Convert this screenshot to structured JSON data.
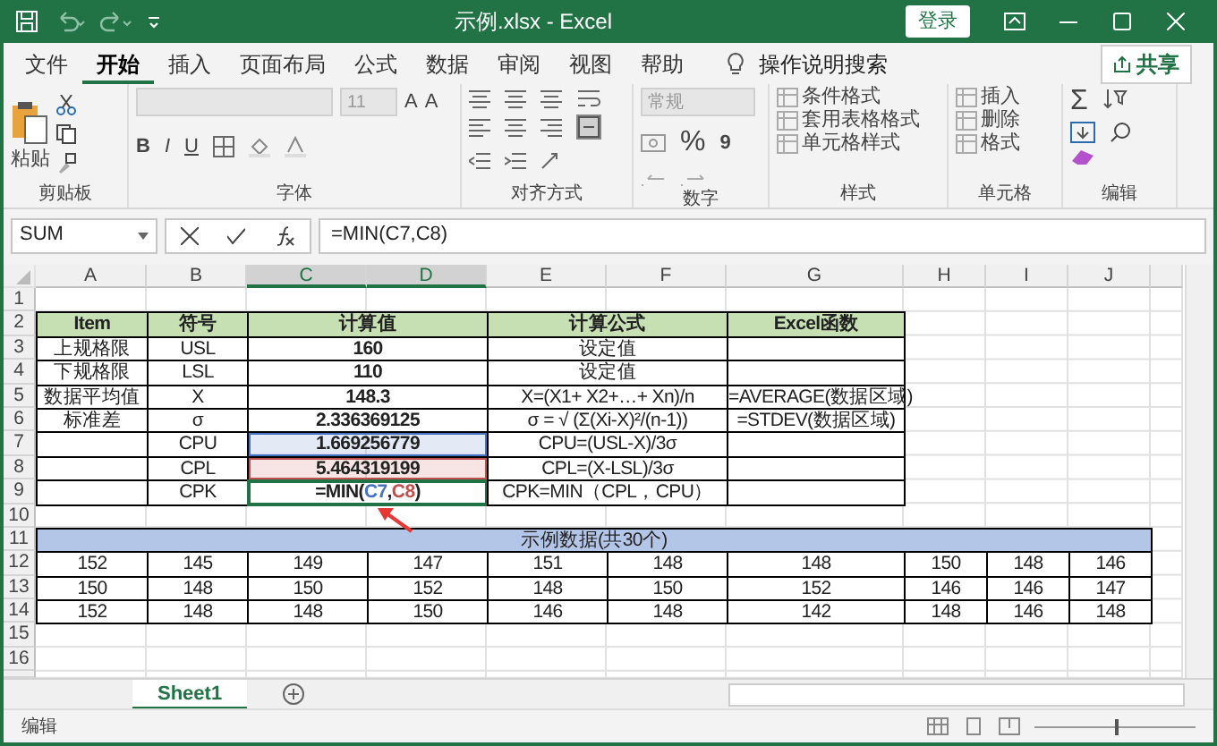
{
  "title_bar": {
    "title": "示例.xlsx  -  Excel",
    "login_button": "登录"
  },
  "tabs": [
    {
      "label": "文件",
      "selected": false
    },
    {
      "label": "开始",
      "selected": true
    },
    {
      "label": "插入",
      "selected": false
    },
    {
      "label": "页面布局",
      "selected": false
    },
    {
      "label": "公式",
      "selected": false
    },
    {
      "label": "数据",
      "selected": false
    },
    {
      "label": "审阅",
      "selected": false
    },
    {
      "label": "视图",
      "selected": false
    },
    {
      "label": "帮助",
      "selected": false
    }
  ],
  "tell_me": "操作说明搜索",
  "share_button": "共享",
  "ribbon": {
    "clipboard": {
      "label": "剪贴板",
      "paste": "粘贴"
    },
    "font": {
      "label": "字体",
      "size": "11",
      "grow": "A",
      "shrink": "A",
      "styles": [
        "B",
        "I",
        "U"
      ],
      "disabled": true
    },
    "alignment": {
      "label": "对齐方式",
      "merge_selected": true
    },
    "number": {
      "label": "数字",
      "format": "常规",
      "percent": "%",
      "comma": "9",
      "disabled": true
    },
    "styles": {
      "label": "样式",
      "items": [
        {
          "label": "条件格式",
          "disabled": true
        },
        {
          "label": "套用表格格式",
          "disabled": true
        },
        {
          "label": "单元格样式",
          "disabled": true
        }
      ]
    },
    "cells": {
      "label": "单元格",
      "items": [
        {
          "label": "插入",
          "disabled": true
        },
        {
          "label": "删除",
          "disabled": true
        },
        {
          "label": "格式",
          "disabled": true
        }
      ]
    },
    "editing": {
      "label": "编辑",
      "sum": "Σ"
    }
  },
  "formula_bar": {
    "name_box": "SUM",
    "formula": "=MIN(C7,C8)"
  },
  "columns": [
    {
      "label": "A",
      "selected": false
    },
    {
      "label": "B",
      "selected": false
    },
    {
      "label": "C",
      "selected": true
    },
    {
      "label": "D",
      "selected": true
    },
    {
      "label": "E",
      "selected": false
    },
    {
      "label": "F",
      "selected": false
    },
    {
      "label": "G",
      "selected": false
    },
    {
      "label": "H",
      "selected": false
    },
    {
      "label": "I",
      "selected": false
    },
    {
      "label": "J",
      "selected": false
    }
  ],
  "rows": [
    {
      "number": "1"
    },
    {
      "number": "2",
      "cells": [
        {
          "text": "Item",
          "kind": "header"
        },
        {
          "text": "符号",
          "kind": "header"
        },
        {
          "merged": true,
          "text": "计算值",
          "kind": "header"
        },
        {
          "merged": true,
          "text": "计算公式",
          "kind": "header"
        },
        {
          "text": "Excel函数",
          "kind": "header"
        }
      ]
    },
    {
      "number": "3",
      "cells": [
        {
          "text": "上规格限"
        },
        {
          "text": "USL"
        },
        {
          "merged": true,
          "text": "160",
          "kind": "bold"
        },
        {
          "merged": true,
          "text": "设定值"
        },
        {
          "kind": "blank"
        }
      ]
    },
    {
      "number": "4",
      "cells": [
        {
          "text": "下规格限"
        },
        {
          "text": "LSL"
        },
        {
          "merged": true,
          "text": "110",
          "kind": "bold"
        },
        {
          "merged": true,
          "text": "设定值"
        },
        {
          "kind": "blank"
        }
      ]
    },
    {
      "number": "5",
      "cells": [
        {
          "text": "数据平均值"
        },
        {
          "text": "X"
        },
        {
          "merged": true,
          "text": "148.3",
          "kind": "bold"
        },
        {
          "merged": true,
          "text": "X=(X1+ X2+…+ Xn)/n"
        },
        {
          "text": "=AVERAGE(数据区域)"
        }
      ]
    },
    {
      "number": "6",
      "cells": [
        {
          "text": "标准差"
        },
        {
          "text": "σ"
        },
        {
          "merged": true,
          "text": "2.336369125",
          "kind": "bold"
        },
        {
          "merged": true,
          "text": "σ = √ (Σ(Xi-X)²/(n-1))"
        },
        {
          "text": "=STDEV(数据区域)"
        }
      ]
    },
    {
      "number": "7",
      "cells": [
        {
          "kind": "blank"
        },
        {
          "text": "CPU"
        },
        {
          "merged": true,
          "text": "1.669256779",
          "kind": "bold",
          "color": "#4472c4"
        },
        {
          "merged": true,
          "text": "CPU=(USL-X)/3σ"
        },
        {
          "kind": "blank"
        }
      ]
    },
    {
      "number": "8",
      "cells": [
        {
          "kind": "blank"
        },
        {
          "text": "CPL"
        },
        {
          "merged": true,
          "text": "5.464319199",
          "kind": "bold",
          "color": "#c0504d"
        },
        {
          "merged": true,
          "text": "CPL=(X-LSL)/3σ"
        },
        {
          "kind": "blank"
        }
      ]
    },
    {
      "number": "9",
      "cells": [
        {
          "kind": "blank"
        },
        {
          "text": "CPK"
        },
        {
          "merged": true,
          "kind": "formula",
          "active": true,
          "parts": [
            {
              "text": "=MIN("
            },
            {
              "text": "C7",
              "color": "#4472c4"
            },
            {
              "text": ","
            },
            {
              "text": "C8",
              "color": "#c0504d"
            },
            {
              "text": ")"
            }
          ]
        },
        {
          "merged": true,
          "text": "CPK=MIN（CPL，CPU）"
        },
        {
          "kind": "blank"
        }
      ]
    },
    {
      "number": "10"
    },
    {
      "number": "11",
      "cells": [
        {
          "text": "示例数据(共30个)",
          "kind": "banner"
        }
      ]
    },
    {
      "number": "12",
      "cells": [
        {
          "text": "152"
        },
        {
          "text": "145"
        },
        {
          "text": "149"
        },
        {
          "text": "147"
        },
        {
          "text": "151"
        },
        {
          "text": "148"
        },
        {
          "text": "148"
        },
        {
          "text": "150"
        },
        {
          "text": "148"
        },
        {
          "text": "146"
        }
      ]
    },
    {
      "number": "13",
      "cells": [
        {
          "text": "150"
        },
        {
          "text": "148"
        },
        {
          "text": "150"
        },
        {
          "text": "152"
        },
        {
          "text": "148"
        },
        {
          "text": "150"
        },
        {
          "text": "152"
        },
        {
          "text": "146"
        },
        {
          "text": "146"
        },
        {
          "text": "147"
        }
      ]
    },
    {
      "number": "14",
      "cells": [
        {
          "text": "152"
        },
        {
          "text": "148"
        },
        {
          "text": "148"
        },
        {
          "text": "150"
        },
        {
          "text": "146"
        },
        {
          "text": "148"
        },
        {
          "text": "142"
        },
        {
          "text": "148"
        },
        {
          "text": "146"
        },
        {
          "text": "148"
        }
      ]
    },
    {
      "number": "15"
    },
    {
      "number": "16"
    }
  ],
  "annotation": {
    "kind": "arrow"
  },
  "sheet_tabs": [
    {
      "label": "Sheet1",
      "selected": true
    }
  ],
  "status_bar": {
    "mode": "编辑",
    "zoom": {
      "level": 0.5
    }
  }
}
